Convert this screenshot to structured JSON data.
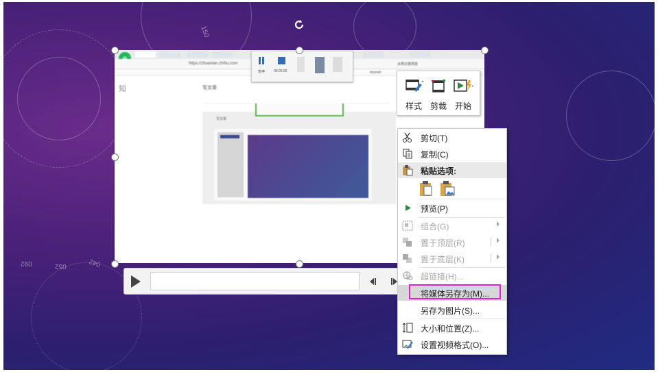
{
  "mini_toolbar": {
    "style_label": "样式",
    "crop_label": "剪裁",
    "start_label": "开始"
  },
  "context_menu": {
    "cut": "剪切(T)",
    "copy": "复制(C)",
    "paste_options": "粘贴选项:",
    "preview": "预览(P)",
    "group": "组合(G)",
    "bring_front": "置于顶层(R)",
    "send_back": "置于底层(K)",
    "hyperlink": "超链接(H)...",
    "save_media_as": "将媒体另存为(M)...",
    "save_as_picture": "另存为图片(S)...",
    "size_position": "大小和位置(Z)...",
    "format_video": "设置视频格式(O)...",
    "highlight_color": "#e020d0"
  },
  "video_content": {
    "url": "https://zhuanlan.zhihu.com",
    "tab_label": "写文章",
    "logo": "知",
    "editor_title": "写文章",
    "recorder_time": "00:00:00",
    "recorder_pause": "暂停",
    "bookmark_label": "doyeah",
    "search_placeholder": "夫明记者网查",
    "compass_numbers": [
      "150",
      "092",
      "052",
      "042",
      "092"
    ]
  }
}
